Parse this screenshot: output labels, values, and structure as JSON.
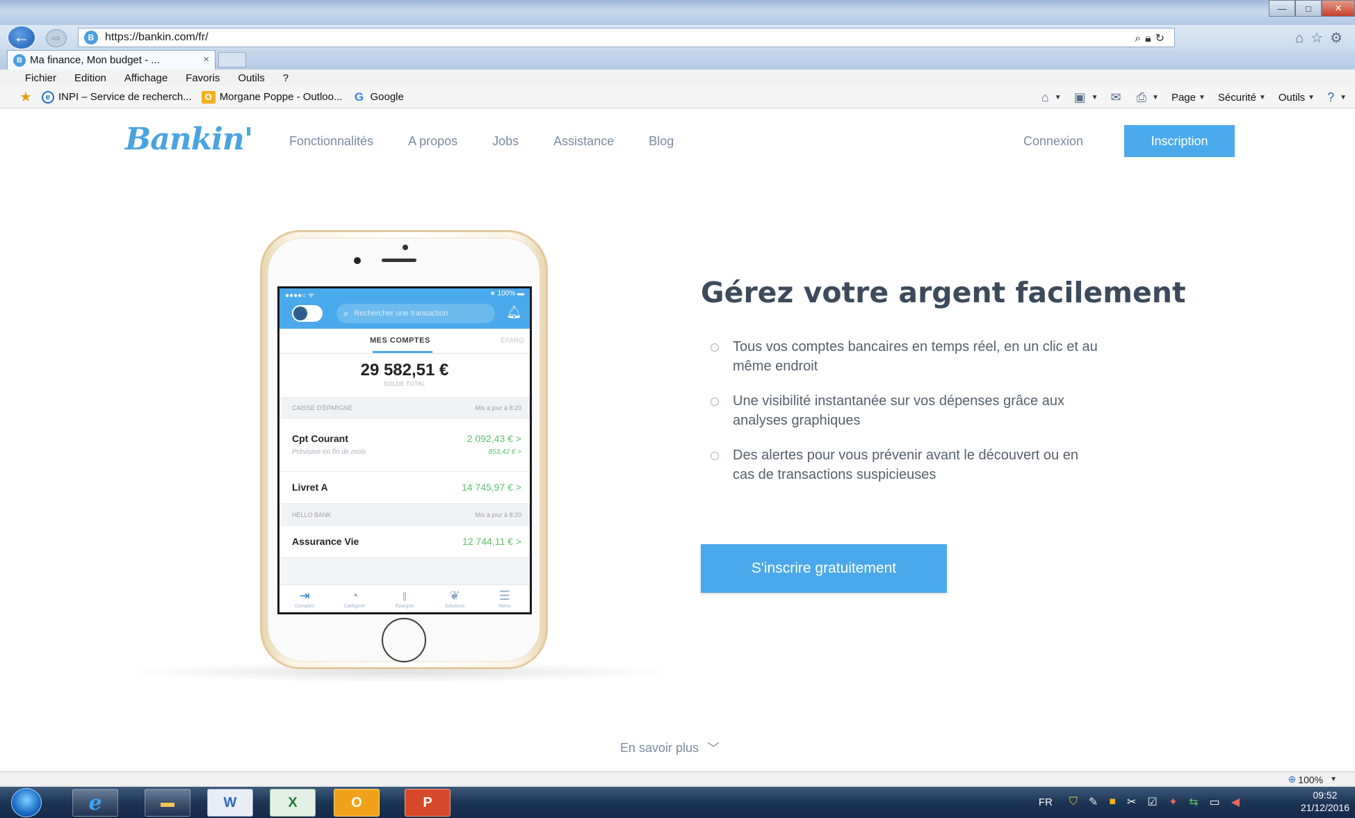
{
  "browser": {
    "url": "https://bankin.com/fr/",
    "tab_title": "Ma finance, Mon budget - ...",
    "tab_close": "×",
    "favicon_letter": "B",
    "window_buttons": {
      "minimize": "—",
      "maximize": "□",
      "close": "✕"
    },
    "menu": [
      "Fichier",
      "Edition",
      "Affichage",
      "Favoris",
      "Outils",
      "?"
    ],
    "favorites": [
      {
        "label": "INPI – Service de recherch...",
        "icon": "ie-icon"
      },
      {
        "label": "Morgane Poppe - Outloo...",
        "icon": "outlook-icon"
      },
      {
        "label": "Google",
        "icon": "google-icon"
      }
    ],
    "commands": {
      "page": "Page",
      "securite": "Sécurité",
      "outils": "Outils"
    },
    "zoom": "100%"
  },
  "site": {
    "logo": "Bankin'",
    "nav": [
      "Fonctionnalités",
      "A propos",
      "Jobs",
      "Assistance",
      "Blog"
    ],
    "connexion": "Connexion",
    "inscription": "Inscription",
    "hero_title": "Gérez votre argent facilement",
    "features": [
      "Tous vos comptes bancaires en temps réel, en un clic et au même endroit",
      "Une visibilité instantanée sur vos dépenses grâce aux analyses graphiques",
      "Des alertes pour vous prévenir avant le découvert ou en cas de transactions suspicieuses"
    ],
    "cta": "S'inscrire gratuitement",
    "learn_more": "En savoir plus"
  },
  "phone_app": {
    "status_left": "●●●●○ ᯤ",
    "status_right": "∗ 100% ▬",
    "search_placeholder": "Rechercher une transaction",
    "tab_active": "MES COMPTES",
    "tab_next": "ÉPARG",
    "total_amount": "29 582,51 €",
    "total_label": "SOLDE TOTAL",
    "sections": [
      {
        "bank": "CAISSE D'ÉPARGNE",
        "updated": "Mis à jour à 8:20"
      },
      {
        "bank": "HELLO BANK",
        "updated": "Mis à jour à 8:20"
      }
    ],
    "accounts": [
      {
        "name": "Cpt Courant",
        "amount": "2 092,43 €  >",
        "sub": "Prévision en fin de mois",
        "sub_amount": "853,42 €  >"
      },
      {
        "name": "Livret A",
        "amount": "14 745,97 €  >"
      },
      {
        "name": "Assurance Vie",
        "amount": "12 744,11 €  >"
      }
    ],
    "bottom_nav": [
      "Comptes",
      "Catégorie",
      "Épargne",
      "Solutions",
      "Menu"
    ]
  },
  "taskbar": {
    "lang": "FR",
    "time": "09:52",
    "date": "21/12/2016"
  }
}
